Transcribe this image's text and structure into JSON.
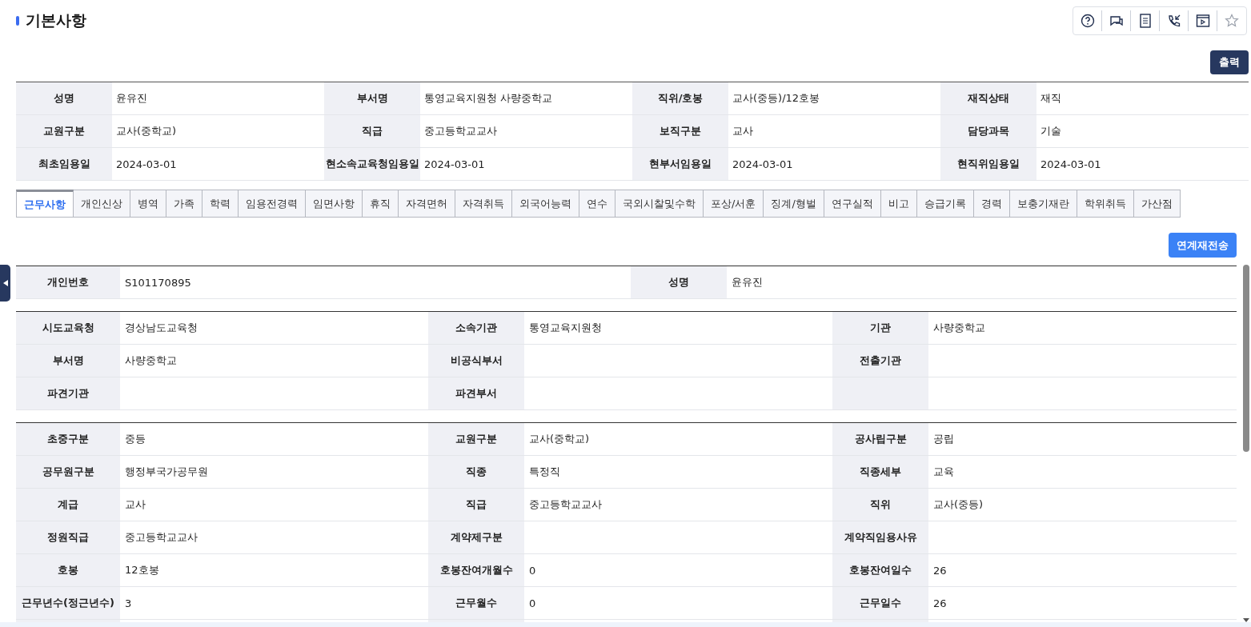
{
  "page": {
    "title": "기본사항"
  },
  "toolbar": {
    "print_button": "출력",
    "resend_button": "연계재전송"
  },
  "summary": [
    [
      {
        "label": "성명",
        "value": "윤유진"
      },
      {
        "label": "부서명",
        "value": "통영교육지원청 사량중학교"
      },
      {
        "label": "직위/호봉",
        "value": "교사(중등)/12호봉"
      },
      {
        "label": "재직상태",
        "value": "재직"
      }
    ],
    [
      {
        "label": "교원구분",
        "value": "교사(중학교)"
      },
      {
        "label": "직급",
        "value": "중고등학교교사"
      },
      {
        "label": "보직구분",
        "value": "교사"
      },
      {
        "label": "담당과목",
        "value": "기술"
      }
    ],
    [
      {
        "label": "최초임용일",
        "value": "2024-03-01"
      },
      {
        "label": "현소속교육청임용일",
        "value": "2024-03-01"
      },
      {
        "label": "현부서임용일",
        "value": "2024-03-01"
      },
      {
        "label": "현직위임용일",
        "value": "2024-03-01"
      }
    ]
  ],
  "tabs": [
    {
      "label": "근무사항",
      "selected": true
    },
    {
      "label": "개인신상",
      "selected": false
    },
    {
      "label": "병역",
      "selected": false
    },
    {
      "label": "가족",
      "selected": false
    },
    {
      "label": "학력",
      "selected": false
    },
    {
      "label": "임용전경력",
      "selected": false
    },
    {
      "label": "임면사항",
      "selected": false
    },
    {
      "label": "휴직",
      "selected": false
    },
    {
      "label": "자격면허",
      "selected": false
    },
    {
      "label": "자격취득",
      "selected": false
    },
    {
      "label": "외국어능력",
      "selected": false
    },
    {
      "label": "연수",
      "selected": false
    },
    {
      "label": "국외시찰및수학",
      "selected": false
    },
    {
      "label": "포상/서훈",
      "selected": false
    },
    {
      "label": "징계/형벌",
      "selected": false
    },
    {
      "label": "연구실적",
      "selected": false
    },
    {
      "label": "비고",
      "selected": false
    },
    {
      "label": "승급기록",
      "selected": false
    },
    {
      "label": "경력",
      "selected": false
    },
    {
      "label": "보충기재란",
      "selected": false
    },
    {
      "label": "학위취득",
      "selected": false
    },
    {
      "label": "가산점",
      "selected": false
    }
  ],
  "sections": [
    {
      "rows": [
        [
          {
            "label": "개인번호",
            "value": "S101170895"
          },
          {
            "label": "성명",
            "value": "윤유진"
          }
        ]
      ]
    },
    {
      "rows": [
        [
          {
            "label": "시도교육청",
            "value": "경상남도교육청"
          },
          {
            "label": "소속기관",
            "value": "통영교육지원청"
          },
          {
            "label": "기관",
            "value": "사량중학교"
          }
        ],
        [
          {
            "label": "부서명",
            "value": "사량중학교"
          },
          {
            "label": "비공식부서"
          },
          {
            "label": "전출기관"
          }
        ],
        [
          {
            "label": "파견기관"
          },
          {
            "label": "파견부서"
          },
          {}
        ]
      ]
    },
    {
      "rows": [
        [
          {
            "label": "초중구분",
            "value": "중등"
          },
          {
            "label": "교원구분",
            "value": "교사(중학교)"
          },
          {
            "label": "공사립구분",
            "value": "공립"
          }
        ],
        [
          {
            "label": "공무원구분",
            "value": "행정부국가공무원"
          },
          {
            "label": "직종",
            "value": "특정직"
          },
          {
            "label": "직종세부",
            "value": "교육"
          }
        ],
        [
          {
            "label": "계급",
            "value": "교사"
          },
          {
            "label": "직급",
            "value": "중고등학교교사"
          },
          {
            "label": "직위",
            "value": "교사(중등)"
          }
        ],
        [
          {
            "label": "정원직급",
            "value": "중고등학교교사"
          },
          {
            "label": "계약제구분"
          },
          {
            "label": "계약직임용사유"
          }
        ],
        [
          {
            "label": "호봉",
            "value": "12호봉"
          },
          {
            "label": "호봉잔여개월수",
            "value": "0"
          },
          {
            "label": "호봉잔여일수",
            "value": "26"
          }
        ],
        [
          {
            "label": "근무년수(정근년수)",
            "value": "3"
          },
          {
            "label": "근무월수",
            "value": "0"
          },
          {
            "label": "근무일수",
            "value": "26"
          }
        ],
        [
          {},
          {},
          {}
        ]
      ]
    }
  ]
}
